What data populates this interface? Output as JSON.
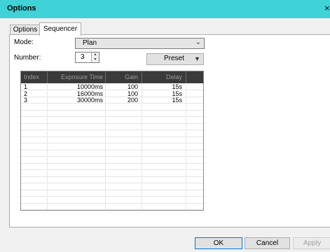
{
  "window": {
    "title": "Options",
    "close_glyph": "×"
  },
  "tabs": [
    {
      "label": "Options"
    },
    {
      "label": "Sequencer"
    }
  ],
  "form": {
    "mode_label": "Mode:",
    "mode_value": "Plan",
    "number_label": "Number:",
    "number_value": "3",
    "preset_label": "Preset"
  },
  "table": {
    "columns": [
      "Index",
      "Exposure Time",
      "Gain",
      "Delay",
      ""
    ],
    "rows": [
      [
        "1",
        "10000ms",
        "100",
        "15s",
        ""
      ],
      [
        "2",
        "16000ms",
        "100",
        "15s",
        ""
      ],
      [
        "3",
        "30000ms",
        "200",
        "15s",
        ""
      ],
      [
        "",
        "",
        "",
        "",
        ""
      ],
      [
        "",
        "",
        "",
        "",
        ""
      ],
      [
        "",
        "",
        "",
        "",
        ""
      ],
      [
        "",
        "",
        "",
        "",
        ""
      ],
      [
        "",
        "",
        "",
        "",
        ""
      ],
      [
        "",
        "",
        "",
        "",
        ""
      ],
      [
        "",
        "",
        "",
        "",
        ""
      ],
      [
        "",
        "",
        "",
        "",
        ""
      ],
      [
        "",
        "",
        "",
        "",
        ""
      ],
      [
        "",
        "",
        "",
        "",
        ""
      ],
      [
        "",
        "",
        "",
        "",
        ""
      ],
      [
        "",
        "",
        "",
        "",
        ""
      ],
      [
        "",
        "",
        "",
        "",
        ""
      ],
      [
        "",
        "",
        "",
        "",
        ""
      ],
      [
        "",
        "",
        "",
        "",
        ""
      ],
      [
        "",
        "",
        "",
        "",
        ""
      ]
    ]
  },
  "buttons": {
    "ok": "OK",
    "cancel": "Cancel",
    "apply": "Apply"
  },
  "colors": {
    "titlebar": "#3fd2d6",
    "header": "#3a3a3a"
  }
}
